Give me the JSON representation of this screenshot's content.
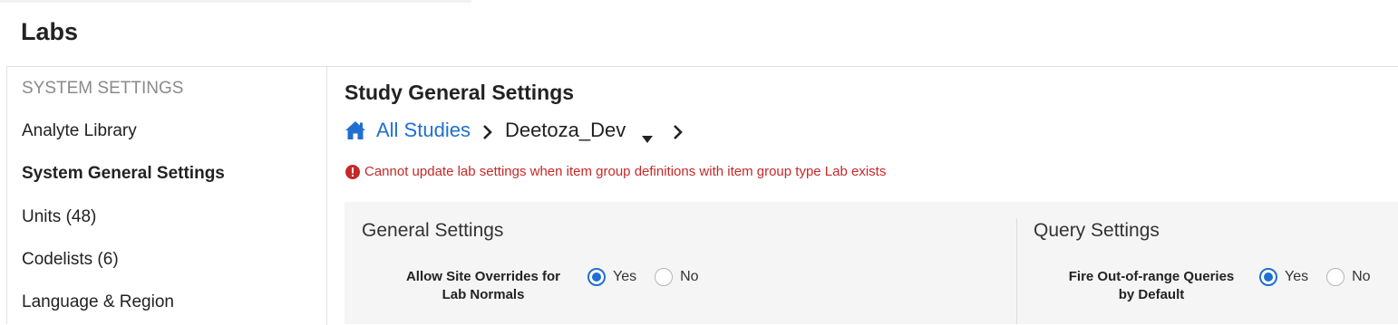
{
  "page": {
    "title": "Labs"
  },
  "sidebar": {
    "items": [
      {
        "label": "SYSTEM SETTINGS"
      },
      {
        "label": "Analyte Library"
      },
      {
        "label": "System General Settings"
      },
      {
        "label": "Units (48)"
      },
      {
        "label": "Codelists (6)"
      },
      {
        "label": "Language & Region"
      }
    ]
  },
  "main": {
    "title": "Study General Settings",
    "breadcrumb": {
      "home_icon": "home-icon",
      "link": "All Studies",
      "current": "Deetoza_Dev"
    },
    "error": {
      "icon": "exclamation-circle-icon",
      "message": "Cannot update lab settings when item group definitions with item group type Lab exists"
    },
    "general": {
      "heading": "General Settings",
      "field": {
        "label_line1": "Allow Site Overrides for",
        "label_line2": "Lab Normals",
        "options": [
          "Yes",
          "No"
        ],
        "selected": "Yes"
      }
    },
    "query": {
      "heading": "Query Settings",
      "field": {
        "label_line1": "Fire Out-of-range Queries",
        "label_line2": "by Default",
        "options": [
          "Yes",
          "No"
        ],
        "selected": "Yes"
      }
    }
  },
  "colors": {
    "accent": "#1f6fd1",
    "error": "#c62828",
    "panel_bg": "#f5f5f5"
  }
}
